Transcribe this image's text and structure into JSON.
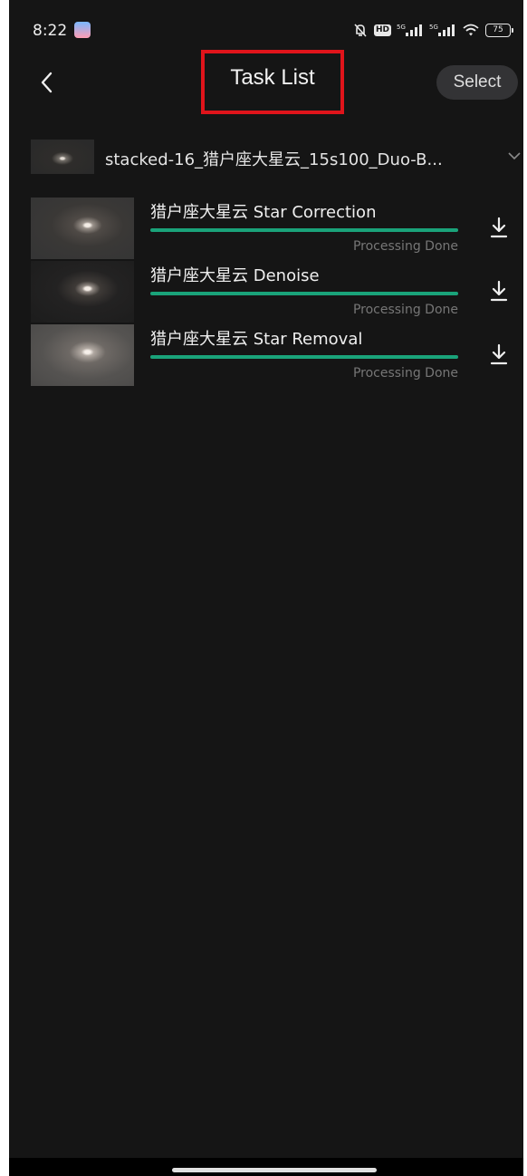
{
  "status_bar": {
    "time": "8:22",
    "hd": "HD",
    "signal1": "5G",
    "signal2": "5G",
    "battery": "75",
    "icons": [
      "app-notification-icon",
      "bell-off-icon",
      "hd-icon",
      "signal-5g-icon",
      "signal-5g-icon",
      "wifi-icon",
      "battery-icon"
    ]
  },
  "header": {
    "back_icon": "chevron-left-icon",
    "title": "Task List",
    "title_highlight_color": "#e0141b",
    "select_label": "Select"
  },
  "file_selector": {
    "file_name": "stacked-16_猎户座大星云_15s100_Duo-B...",
    "icon": "chevron-down-icon"
  },
  "tasks": [
    {
      "title": "猎户座大星云 Star Correction",
      "status": "Processing Done",
      "progress": 1.0,
      "icon": "download-icon"
    },
    {
      "title": "猎户座大星云 Denoise",
      "status": "Processing Done",
      "progress": 1.0,
      "icon": "download-icon"
    },
    {
      "title": "猎户座大星云 Star Removal",
      "status": "Processing Done",
      "progress": 1.0,
      "icon": "download-icon"
    }
  ],
  "colors": {
    "background": "#151515",
    "progress": "#1aa37a",
    "status_text": "#767676"
  }
}
